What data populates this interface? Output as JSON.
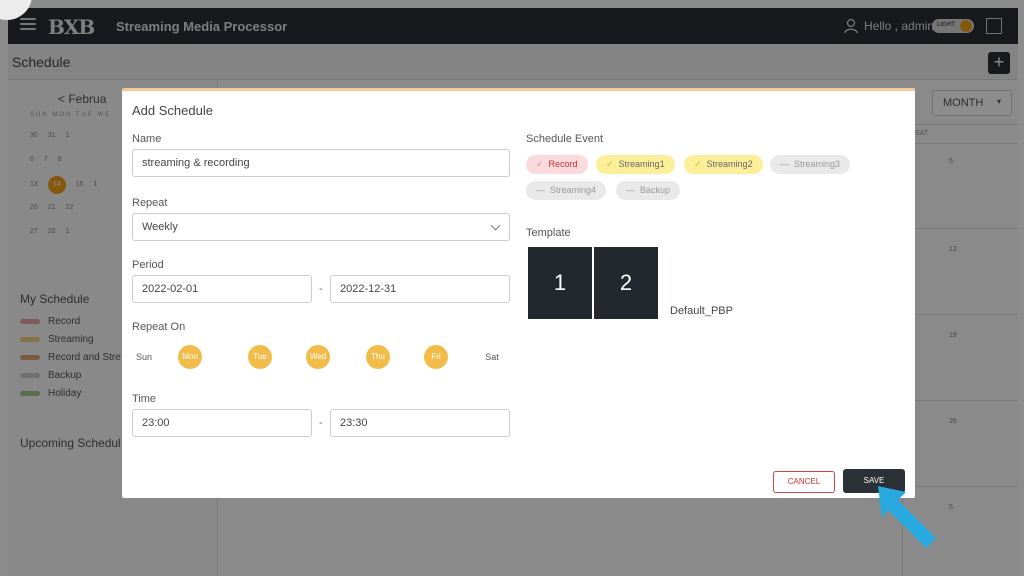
{
  "topbar": {
    "logo": "BXB",
    "app_title": "Streaming Media Processor",
    "greeting": "Hello , admin",
    "theme_toggle_label": "LIGHT"
  },
  "subbar": {
    "title": "Schedule",
    "add_label": "+"
  },
  "sidebar": {
    "month_nav": "<  Februa",
    "dow": "SUN MON TUE WE",
    "cal_rows": [
      "30 31 1",
      "6 7 8",
      "13",
      "20 21 22",
      "27 28 1"
    ],
    "today": "14",
    "row3_rest": "15 1",
    "my_schedule": "My Schedule",
    "legend": [
      {
        "label": "Record",
        "color": "#e9a3a8"
      },
      {
        "label": "Streaming",
        "color": "#f2d27a"
      },
      {
        "label": "Record and Stre",
        "color": "#e2a472"
      },
      {
        "label": "Backup",
        "color": "#cccccc"
      },
      {
        "label": "Holiday",
        "color": "#9fcd8a"
      }
    ],
    "upcoming": "Upcoming Schedul"
  },
  "calendar": {
    "view": "MONTH",
    "sat_header": "SAT",
    "sat_days": [
      "5",
      "12",
      "19",
      "26",
      "5"
    ]
  },
  "modal": {
    "title": "Add Schedule",
    "name_label": "Name",
    "name_value": "streaming & recording",
    "repeat_label": "Repeat",
    "repeat_value": "Weekly",
    "period_label": "Period",
    "period_start": "2022-02-01",
    "period_end": "2022-12-31",
    "period_sep": "-",
    "repeat_on_label": "Repeat On",
    "days": [
      {
        "label": "Sun",
        "on": false
      },
      {
        "label": "Mon",
        "on": true
      },
      {
        "label": "Tue",
        "on": true
      },
      {
        "label": "Wed",
        "on": true
      },
      {
        "label": "Thu",
        "on": true
      },
      {
        "label": "Fri",
        "on": true
      },
      {
        "label": "Sat",
        "on": false
      }
    ],
    "time_label": "Time",
    "time_start": "23:00",
    "time_end": "23:30",
    "time_sep": "-",
    "event_label": "Schedule Event",
    "events": [
      {
        "label": "Record",
        "mark": "✓",
        "style": "red"
      },
      {
        "label": "Streaming1",
        "mark": "✓",
        "style": "yellow"
      },
      {
        "label": "Streaming2",
        "mark": "✓",
        "style": "yellow"
      },
      {
        "label": "Streaming3",
        "mark": "—",
        "style": "grey"
      },
      {
        "label": "Streaming4",
        "mark": "—",
        "style": "grey"
      },
      {
        "label": "Backup",
        "mark": "—",
        "style": "grey"
      }
    ],
    "template_label": "Template",
    "template_cells": [
      "1",
      "2"
    ],
    "template_name": "Default_PBP",
    "cancel_label": "CANCEL",
    "save_label": "SAVE"
  },
  "colors": {
    "accent": "#f2bc4a",
    "dark": "#2b2f36",
    "pointer": "#27a9df"
  }
}
